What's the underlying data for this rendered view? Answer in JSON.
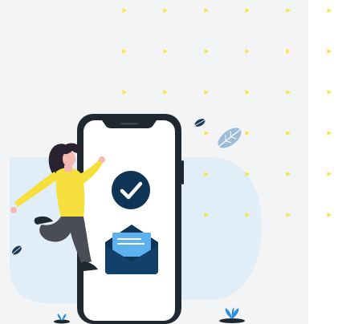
{
  "illustration": {
    "subject": "woman-jumping-with-phone",
    "phone_status_icon": "check-circle-icon",
    "phone_message_icon": "open-envelope-icon",
    "decorations": [
      "leaf-icon",
      "triangle-dot-pattern",
      "blob-background",
      "ground-plant-icon"
    ]
  },
  "colors": {
    "panel_background": "#f3f4f6",
    "blob": "#e1eef8",
    "dot_pattern": "#f5e44b",
    "navy": "#0f3556",
    "phone_frame": "#1f2730",
    "phone_screen": "#ffffff",
    "shirt": "#f7df3d",
    "pants": "#4a4d55",
    "hair": "#2a2230",
    "skin": "#f6b9b1",
    "letter": "#5cb1ee",
    "leaf": "#9cbcd8",
    "plant": "#2f8de0"
  }
}
